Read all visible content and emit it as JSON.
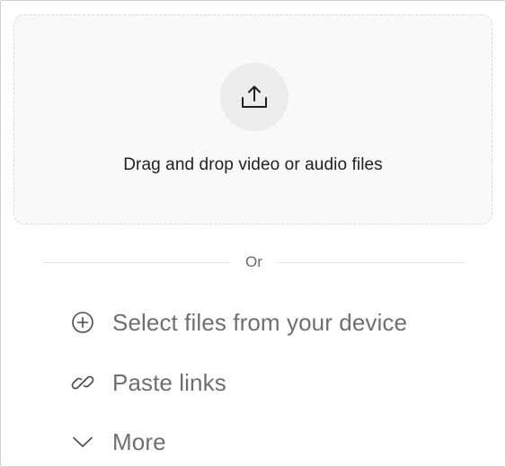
{
  "dropzone": {
    "text": "Drag and drop video or audio files",
    "icon": "upload-icon"
  },
  "divider": {
    "text": "Or"
  },
  "options": [
    {
      "label": "Select files from your device",
      "icon": "plus-circle-icon"
    },
    {
      "label": "Paste links",
      "icon": "link-icon"
    },
    {
      "label": "More",
      "icon": "chevron-down-icon"
    }
  ],
  "colors": {
    "dropzone_bg": "#f9f9f9",
    "icon_circle_bg": "#ececec",
    "option_text": "#6f6f6f"
  }
}
